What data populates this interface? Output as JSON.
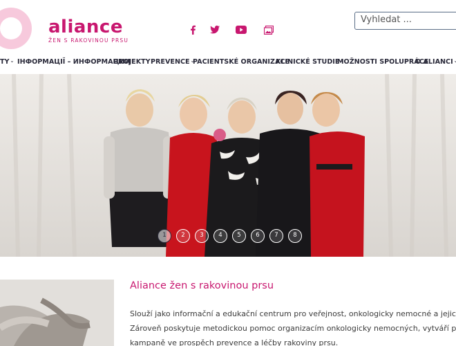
{
  "brand": {
    "name": "aliance",
    "tagline": "ŽEN S RAKOVINOU PRSU",
    "color": "#c8176f"
  },
  "socials": [
    {
      "icon": "facebook-icon"
    },
    {
      "icon": "twitter-icon"
    },
    {
      "icon": "youtube-icon"
    },
    {
      "icon": "gallery-icon"
    }
  ],
  "search": {
    "placeholder": "Vyhledat ..."
  },
  "nav": {
    "items": [
      {
        "label": "TY",
        "dropdown": true
      },
      {
        "label": "ІНФОРМАЦІЇ – ИНФОРМАЦИИ",
        "dropdown": false
      },
      {
        "label": "PROJEKTY",
        "dropdown": false
      },
      {
        "label": "PREVENCE",
        "dropdown": true
      },
      {
        "label": "PACIENTSKÉ ORGANIZACE",
        "dropdown": false
      },
      {
        "label": "KLINICKÉ STUDIE",
        "dropdown": true
      },
      {
        "label": "MOŽNOSTI SPOLUPRÁCE",
        "dropdown": false
      },
      {
        "label": "O ALIANCI",
        "dropdown": true
      }
    ]
  },
  "slider": {
    "slides": [
      "1",
      "2",
      "3",
      "4",
      "5",
      "6",
      "7",
      "8"
    ],
    "active": 0
  },
  "intro": {
    "title": "Aliance žen s rakovinou prsu",
    "lines": [
      "Slouží jako informační a edukační centrum pro veřejnost, onkologicky nemocné a jejich organizace.",
      "Zároveň poskytuje metodickou pomoc organizacím onkologicky nemocných, vytváří projekty a",
      "kampaně ve prospěch prevence a léčby rakoviny prsu."
    ]
  }
}
